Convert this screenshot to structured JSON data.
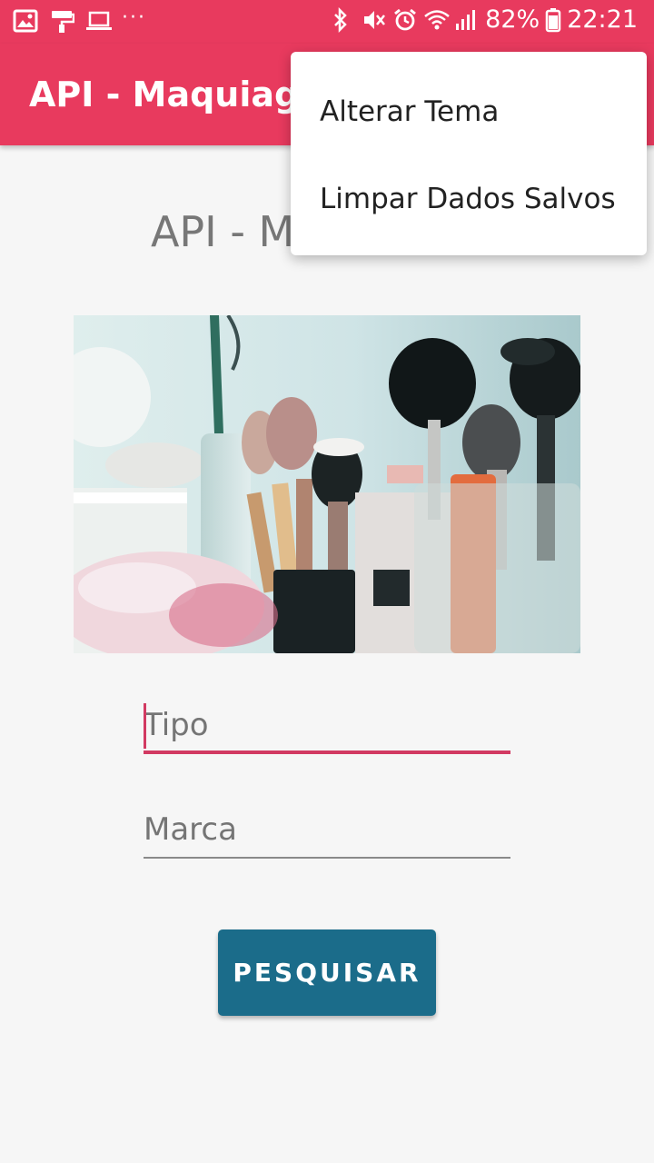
{
  "status_bar": {
    "left_icons": [
      "gallery-icon",
      "paint-roller-icon",
      "laptop-icon",
      "more-dots-icon"
    ],
    "more_dots": "···",
    "right_icons": [
      "bluetooth-icon",
      "mute-icon",
      "alarm-icon",
      "wifi-icon",
      "signal-icon"
    ],
    "battery_percent": "82%",
    "time": "22:21"
  },
  "app_bar": {
    "title": "API - Maquiagem"
  },
  "main": {
    "title": "API - Maquiagem",
    "image_description_icon": "makeup-brushes-photo"
  },
  "form": {
    "tipo_placeholder": "Tipo",
    "marca_placeholder": "Marca",
    "search_button": "PESQUISAR"
  },
  "overflow_menu": {
    "items": [
      {
        "label": "Alterar Tema"
      },
      {
        "label": "Limpar Dados Salvos"
      }
    ]
  },
  "colors": {
    "primary": "#e83a5e",
    "accent": "#d23a62",
    "button": "#1b6c8a",
    "background": "#f6f6f6"
  }
}
